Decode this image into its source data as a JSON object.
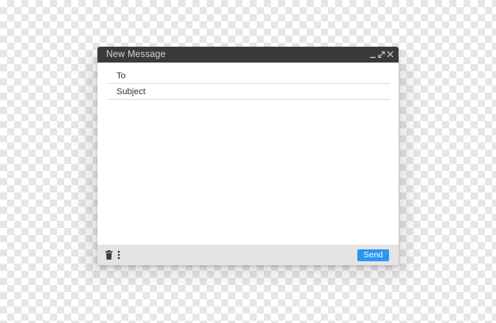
{
  "window": {
    "title": "New Message"
  },
  "compose": {
    "to_label": "To",
    "subject_label": "Subject"
  },
  "footer": {
    "send_label": "Send",
    "icons": [
      "trash-icon",
      "more-options-icon"
    ]
  },
  "titlebar_icons": [
    "minimize-icon",
    "expand-icon",
    "close-icon"
  ],
  "colors": {
    "titlebar": "#3a3a3a",
    "footer": "#e4e4e4",
    "send_button": "#2a96f0"
  }
}
